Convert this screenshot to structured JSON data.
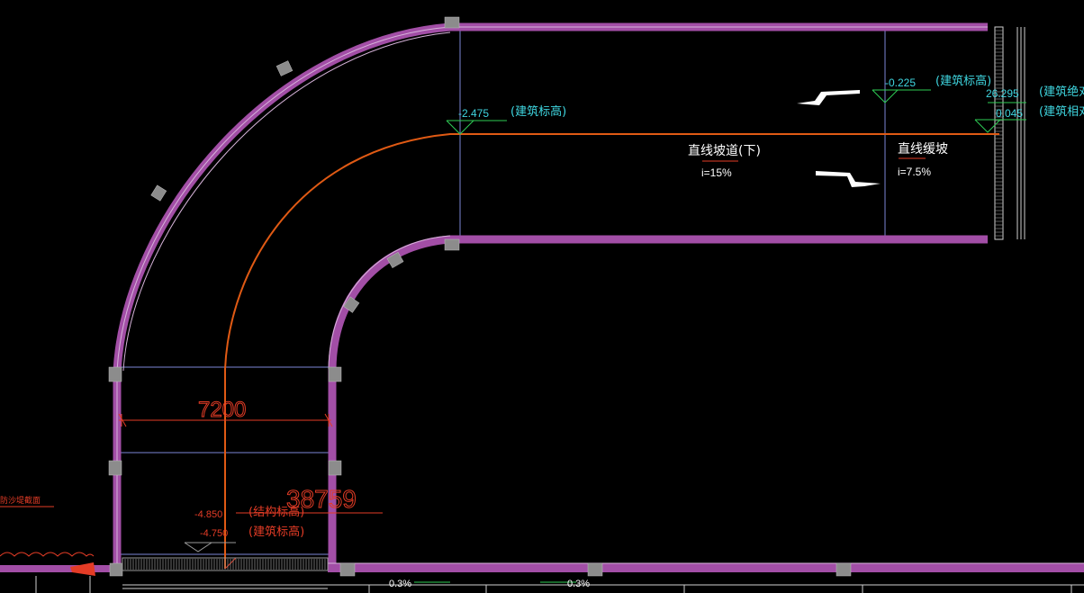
{
  "drawing": {
    "background": "#000000",
    "colors": {
      "wall": "#a24ea6",
      "wall_edge": "#d7b4da",
      "column": "#8c8c8c",
      "centerline": "#e05a14",
      "guide": "#7b86d6",
      "level": "#2ecc55",
      "cyan_text": "#3fd6e0",
      "red_text": "#e43c26",
      "white": "#ffffff",
      "grey": "#9a9a9a"
    },
    "labels": {
      "elev_upper_mid_value": "-2.475",
      "elev_upper_mid_note": "(建筑标高)",
      "elev_upper_right_value": "-0.225",
      "elev_upper_right_note": "(建筑标高)",
      "elev_edge_top_value": "26.295",
      "elev_edge_top_note": "(建筑绝对",
      "elev_edge_bottom_value": "0.045",
      "elev_edge_bottom_note": "(建筑相对",
      "ramp_straight_title": "直线坡道(下)",
      "ramp_straight_slope": "i=15%",
      "ramp_gentle_title": "直线缓坡",
      "ramp_gentle_slope": "i=7.5%",
      "width_dimension": "7200",
      "length_dimension": "38759",
      "elev_struct_value": "-4.850",
      "elev_struct_note": "(结构标高)",
      "elev_arch_value": "-4.750",
      "elev_arch_note": "(建筑标高)",
      "trench_slope_left": "0.3%",
      "trench_slope_right": "0.3%",
      "left_edge_note": "防沙堤截面"
    }
  }
}
